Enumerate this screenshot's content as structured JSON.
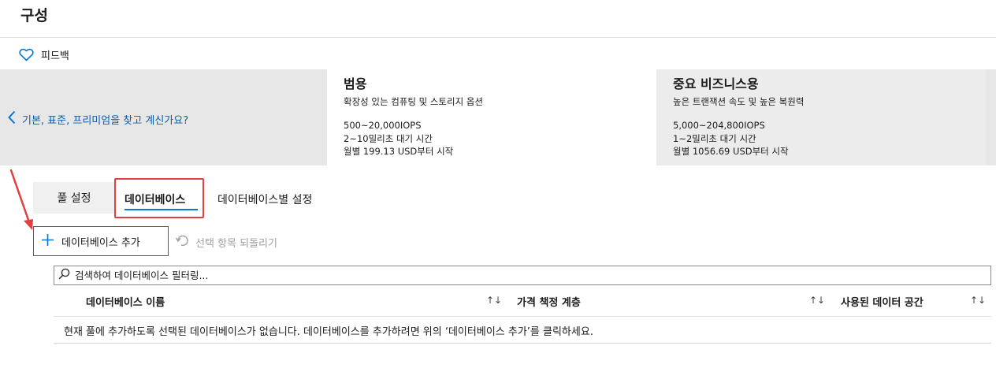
{
  "page": {
    "title": "구성"
  },
  "feedback": {
    "label": "피드백"
  },
  "tiers": {
    "back_link": "기본, 표준, 프리미엄을 찾고 계신가요?",
    "general": {
      "title": "범용",
      "desc": "확장성 있는 컴퓨팅 및 스토리지 옵션",
      "iops": "500~20,000IOPS",
      "latency": "2~10밀리초 대기 시간",
      "price": "월별 199.13 USD부터 시작"
    },
    "business": {
      "title": "중요 비즈니스용",
      "desc": "높은 트랜잭션 속도 및 높은 복원력",
      "iops": "5,000~204,800IOPS",
      "latency": "1~2밀리초 대기 시간",
      "price": "월별 1056.69 USD부터 시작"
    }
  },
  "tabs": {
    "pool": "풀 설정",
    "databases": "데이터베이스",
    "per_database": "데이터베이스별 설정"
  },
  "toolbar": {
    "add": "데이터베이스 추가",
    "revert": "선택 항목 되돌리기"
  },
  "search": {
    "placeholder": "검색하여 데이터베이스 필터링..."
  },
  "table": {
    "columns": [
      "데이터베이스 이름",
      "가격 책정 계층",
      "사용된 데이터 공간"
    ],
    "sort_symbol": "↑↓",
    "empty": "현재 풀에 추가하도록 선택된 데이터베이스가 없습니다. 데이터베이스를 추가하려면 위의 ‘데이터베이스 추가’를 클릭하세요."
  },
  "colors": {
    "accent": "#0078d4",
    "highlight": "#e04040",
    "strip": "#e7e7e7"
  }
}
